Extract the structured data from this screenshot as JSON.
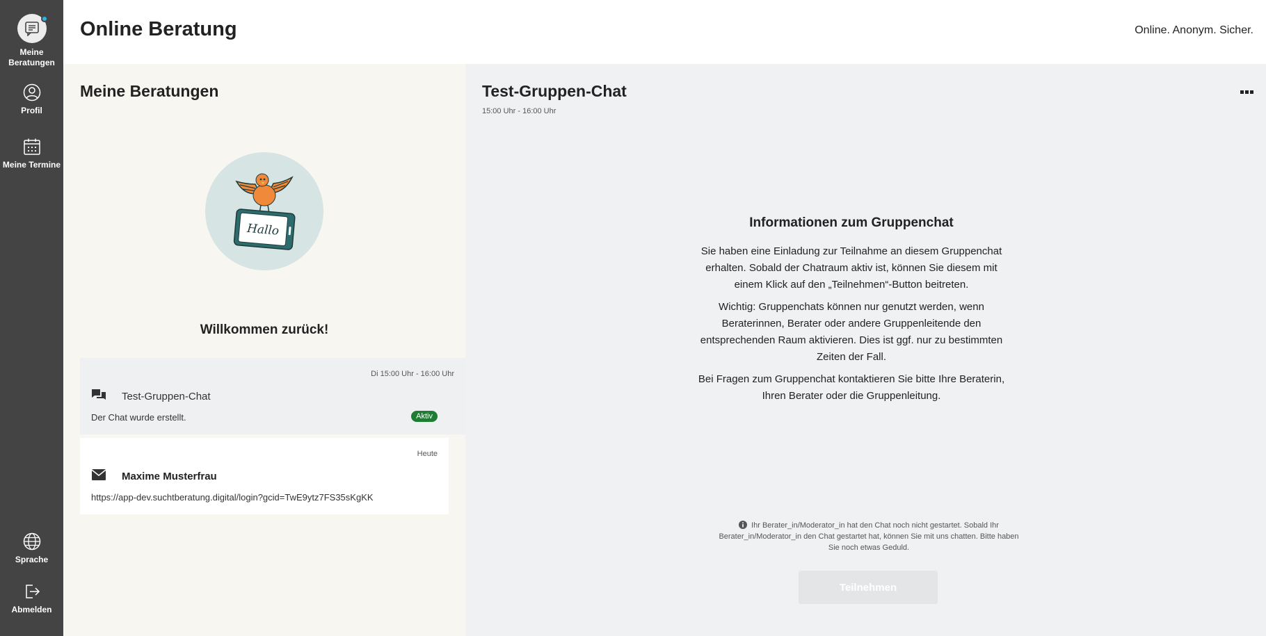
{
  "sidebar": {
    "items": [
      {
        "label": "Meine Beratungen",
        "icon": "chat-list-icon",
        "active": true
      },
      {
        "label": "Profil",
        "icon": "user-icon"
      },
      {
        "label": "Meine Termine",
        "icon": "calendar-icon"
      },
      {
        "label": "Sprache",
        "icon": "globe-icon"
      },
      {
        "label": "Abmelden",
        "icon": "logout-icon"
      }
    ]
  },
  "header": {
    "title": "Online Beratung",
    "tagline": "Online. Anonym. Sicher."
  },
  "list": {
    "title": "Meine Beratungen",
    "illustration_text": "Hallo",
    "welcome": "Willkommen zurück!",
    "sessions": [
      {
        "date": "Di 15:00 Uhr - 16:00 Uhr",
        "name": "Test-Gruppen-Chat",
        "message": "Der Chat wurde erstellt.",
        "badge": "Aktiv",
        "icon": "group-chat-icon"
      },
      {
        "date": "Heute",
        "name": "Maxime Musterfrau",
        "message": "https://app-dev.suchtberatung.digital/login?gcid=TwE9ytz7FS35sKgKK",
        "icon": "envelope-icon"
      }
    ]
  },
  "chat": {
    "title": "Test-Gruppen-Chat",
    "time": "15:00 Uhr - 16:00 Uhr",
    "info_title": "Informationen zum Gruppenchat",
    "info_paragraphs": [
      "Sie haben eine Einladung zur Teilnahme an diesem Gruppenchat erhalten. Sobald der Chatraum aktiv ist, können Sie diesem mit einem Klick auf den „Teilnehmen“-Button beitreten.",
      "Wichtig: Gruppenchats können nur genutzt werden, wenn Beraterinnen, Berater oder andere Gruppenleitende den entsprechenden Raum aktivieren. Dies ist ggf. nur zu bestimmten Zeiten der Fall.",
      "Bei Fragen zum Gruppenchat kontaktieren Sie bitte Ihre Beraterin, Ihren Berater oder die Gruppenleitung."
    ],
    "notice": "Ihr Berater_in/Moderator_in hat den Chat noch nicht gestartet. Sobald Ihr Berater_in/Moderator_in den Chat gestartet hat, können Sie mit uns chatten. Bitte haben Sie noch etwas Geduld.",
    "join_label": "Teilnehmen"
  },
  "colors": {
    "sidebar": "#444444",
    "list_bg": "#f8f6f0",
    "chat_bg": "#f0f1f3",
    "badge_green": "#1e7d33",
    "notification": "#2db4e2",
    "bird_orange": "#f08a3a"
  }
}
